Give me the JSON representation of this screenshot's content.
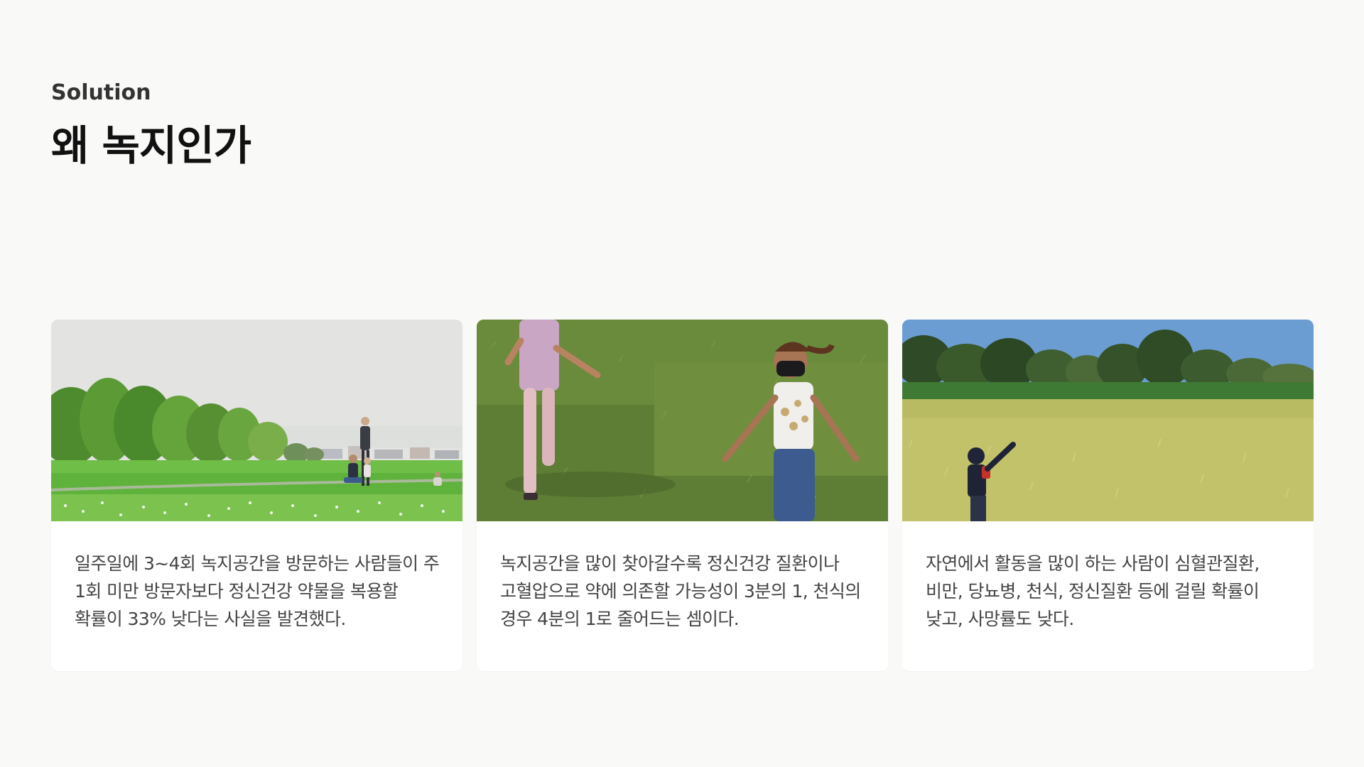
{
  "header": {
    "eyebrow": "Solution",
    "title": "왜 녹지인가"
  },
  "cards": [
    {
      "image": "family-playing-in-park-photo",
      "text": "일주일에 3~4회 녹지공간을 방문하는 사람들이 주 1회 미만 방문자보다 정신건강 약물을 복용할 확률이 33% 낮다는 사실을 발견했다."
    },
    {
      "image": "children-running-on-grass-photo",
      "text": "녹지공간을 많이 찾아갈수록 정신건강 질환이나 고혈압으로 약에 의존할 가능성이 3분의 1, 천식의 경우 4분의 1로 줄어드는 셈이다."
    },
    {
      "image": "child-in-wheat-field-photo",
      "text": "자연에서 활동을 많이 하는 사람이 심혈관질환, 비만, 당뇨병, 천식, 정신질환 등에 걸릴 확률이 낮고, 사망률도 낮다."
    }
  ],
  "colors": {
    "background": "#f9f9f7",
    "card": "#ffffff",
    "title": "#111111",
    "body": "#444444"
  }
}
